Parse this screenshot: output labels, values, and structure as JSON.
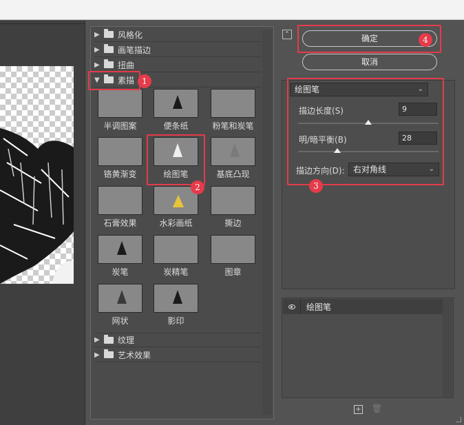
{
  "categories_top": [
    {
      "label": "风格化",
      "expanded": false
    },
    {
      "label": "画笔描边",
      "expanded": false
    },
    {
      "label": "扭曲",
      "expanded": false
    },
    {
      "label": "素描",
      "expanded": true
    }
  ],
  "sketch_filters": [
    {
      "label": "半调图案",
      "style": "dark"
    },
    {
      "label": "便条纸",
      "style": "light"
    },
    {
      "label": "粉笔和炭笔",
      "style": "mid"
    },
    {
      "label": "铬黄渐变",
      "style": "light"
    },
    {
      "label": "绘图笔",
      "style": "dark"
    },
    {
      "label": "基底凸现",
      "style": "mid"
    },
    {
      "label": "石膏效果",
      "style": "mid"
    },
    {
      "label": "水彩画纸",
      "style": "color"
    },
    {
      "label": "撕边",
      "style": "dark"
    },
    {
      "label": "炭笔",
      "style": "light"
    },
    {
      "label": "炭精笔",
      "style": "mid"
    },
    {
      "label": "图章",
      "style": "light"
    },
    {
      "label": "网状",
      "style": "mid"
    },
    {
      "label": "影印",
      "style": "light"
    }
  ],
  "categories_bottom": [
    {
      "label": "纹理",
      "expanded": false
    },
    {
      "label": "艺术效果",
      "expanded": false
    }
  ],
  "buttons": {
    "ok": "确定",
    "cancel": "取消"
  },
  "settings": {
    "filter_select": "绘图笔",
    "stroke_length_label": "描边长度(S)",
    "stroke_length_value": "9",
    "light_dark_label": "明/暗平衡(B)",
    "light_dark_value": "28",
    "direction_label": "描边方向(D):",
    "direction_value": "右对角线"
  },
  "sliders": {
    "stroke_length_fraction": 0.5,
    "light_dark_fraction": 0.28
  },
  "layers": {
    "layer_name": "绘图笔"
  },
  "annotations": {
    "b1": "1",
    "b2": "2",
    "b3": "3",
    "b4": "4",
    "color": "#e53b4a"
  },
  "scroll_arrows": {
    "left": "◀",
    "right": "▶"
  },
  "icons": {
    "collapse": "collapse-panel-icon",
    "new_layer": "new-effect-layer-icon",
    "delete": "trash-icon"
  }
}
